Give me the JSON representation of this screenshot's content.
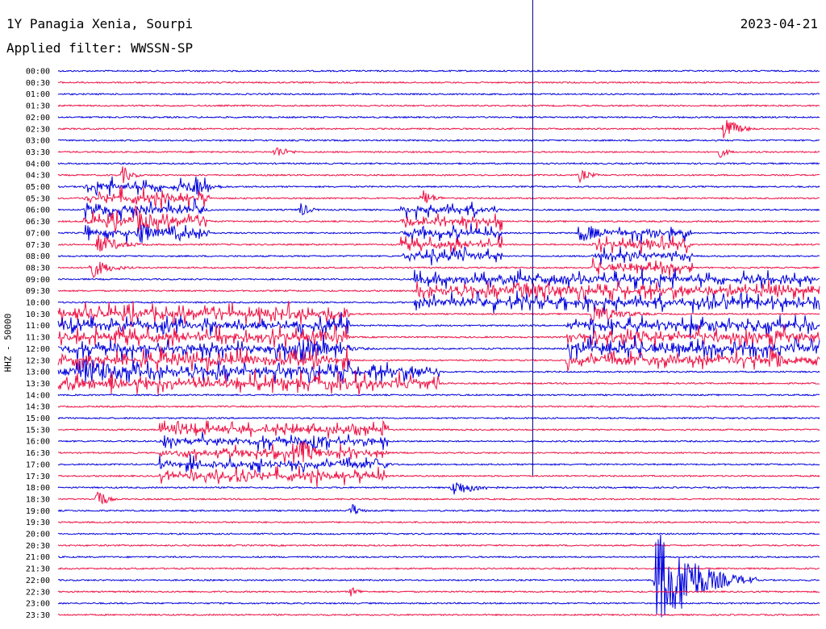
{
  "header": {
    "station": "1Y Panagia Xenia, Sourpi",
    "date": "2023-04-21",
    "filter": "Applied filter: WWSSN-SP"
  },
  "axis": {
    "vertical_label": "HHZ - 50000"
  },
  "colors": {
    "even_row": "#0000dd",
    "odd_row": "#ee1144",
    "marker": "#000080",
    "background": "#ffffff"
  },
  "chart_data": {
    "type": "seismogram helicorder",
    "row_labels": [
      "00:00",
      "00:30",
      "01:00",
      "01:30",
      "02:00",
      "02:30",
      "03:00",
      "03:30",
      "04:00",
      "04:30",
      "05:00",
      "05:30",
      "06:00",
      "06:30",
      "07:00",
      "07:30",
      "08:00",
      "08:30",
      "09:00",
      "09:30",
      "10:00",
      "10:30",
      "11:00",
      "11:30",
      "12:00",
      "12:30",
      "13:00",
      "13:30",
      "14:00",
      "14:30",
      "15:00",
      "15:30",
      "16:00",
      "16:30",
      "17:00",
      "17:30",
      "18:00",
      "18:30",
      "19:00",
      "19:30",
      "20:00",
      "20:30",
      "21:00",
      "21:30",
      "22:00",
      "22:30",
      "23:00",
      "23:30"
    ],
    "trace_minutes": 30,
    "current_time_marker_minute": 18.7,
    "events": [
      {
        "row": 5,
        "minute": 26.2,
        "amp": 18,
        "dur": 1.5
      },
      {
        "row": 7,
        "minute": 8.5,
        "amp": 10,
        "dur": 1.4
      },
      {
        "row": 7,
        "minute": 26.0,
        "amp": 9,
        "dur": 1.0
      },
      {
        "row": 9,
        "minute": 2.5,
        "amp": 14,
        "dur": 1.0
      },
      {
        "row": 9,
        "minute": 20.5,
        "amp": 10,
        "dur": 1.2
      },
      {
        "row": 10,
        "minute": 5.3,
        "amp": 18,
        "dur": 1.5
      },
      {
        "row": 11,
        "minute": 14.3,
        "amp": 14,
        "dur": 1.2
      },
      {
        "row": 12,
        "minute": 9.5,
        "amp": 12,
        "dur": 1.0
      },
      {
        "row": 13,
        "minute": 3.0,
        "amp": 22,
        "dur": 1.8
      },
      {
        "row": 14,
        "minute": 3.2,
        "amp": 18,
        "dur": 1.5
      },
      {
        "row": 14,
        "minute": 20.5,
        "amp": 16,
        "dur": 2.0
      },
      {
        "row": 15,
        "minute": 1.5,
        "amp": 14,
        "dur": 2.5
      },
      {
        "row": 16,
        "minute": 15.5,
        "amp": 14,
        "dur": 2.0
      },
      {
        "row": 17,
        "minute": 1.2,
        "amp": 16,
        "dur": 2.0
      },
      {
        "row": 19,
        "minute": 18.0,
        "amp": 18,
        "dur": 4.0
      },
      {
        "row": 21,
        "minute": 21.0,
        "amp": 14,
        "dur": 3.0
      },
      {
        "row": 23,
        "minute": 28.0,
        "amp": 18,
        "dur": 2.0
      },
      {
        "row": 24,
        "minute": 9.5,
        "amp": 20,
        "dur": 3.0
      },
      {
        "row": 25,
        "minute": 28.0,
        "amp": 22,
        "dur": 1.5
      },
      {
        "row": 26,
        "minute": 1.0,
        "amp": 24,
        "dur": 3.0
      },
      {
        "row": 27,
        "minute": 2.0,
        "amp": 14,
        "dur": 1.0
      },
      {
        "row": 32,
        "minute": 10.0,
        "amp": 16,
        "dur": 1.5
      },
      {
        "row": 33,
        "minute": 9.5,
        "amp": 18,
        "dur": 2.0
      },
      {
        "row": 34,
        "minute": 12.5,
        "amp": 10,
        "dur": 1.0
      },
      {
        "row": 35,
        "minute": 7.0,
        "amp": 18,
        "dur": 1.5
      },
      {
        "row": 36,
        "minute": 15.5,
        "amp": 12,
        "dur": 2.5
      },
      {
        "row": 37,
        "minute": 1.5,
        "amp": 22,
        "dur": 0.8
      },
      {
        "row": 38,
        "minute": 11.5,
        "amp": 14,
        "dur": 0.8
      },
      {
        "row": 44,
        "minute": 23.5,
        "amp": 70,
        "dur": 4.0
      },
      {
        "row": 44,
        "minute": 24.5,
        "amp": 45,
        "dur": 3.0
      },
      {
        "row": 45,
        "minute": 11.5,
        "amp": 8,
        "dur": 1.0
      }
    ],
    "busy_bands": [
      {
        "rows": [
          10,
          14
        ],
        "minute_start": 1.0,
        "minute_end": 6.0,
        "amp": 14
      },
      {
        "rows": [
          12,
          16
        ],
        "minute_start": 13.5,
        "minute_end": 17.5,
        "amp": 12
      },
      {
        "rows": [
          14,
          17
        ],
        "minute_start": 21.0,
        "minute_end": 25.0,
        "amp": 12
      },
      {
        "rows": [
          18,
          20
        ],
        "minute_start": 14.0,
        "minute_end": 30.0,
        "amp": 14
      },
      {
        "rows": [
          21,
          25
        ],
        "minute_start": 0.0,
        "minute_end": 11.5,
        "amp": 16
      },
      {
        "rows": [
          22,
          25
        ],
        "minute_start": 20.0,
        "minute_end": 30.0,
        "amp": 16
      },
      {
        "rows": [
          26,
          27
        ],
        "minute_start": 0.0,
        "minute_end": 15.0,
        "amp": 16
      },
      {
        "rows": [
          31,
          35
        ],
        "minute_start": 4.0,
        "minute_end": 13.0,
        "amp": 12
      }
    ]
  }
}
